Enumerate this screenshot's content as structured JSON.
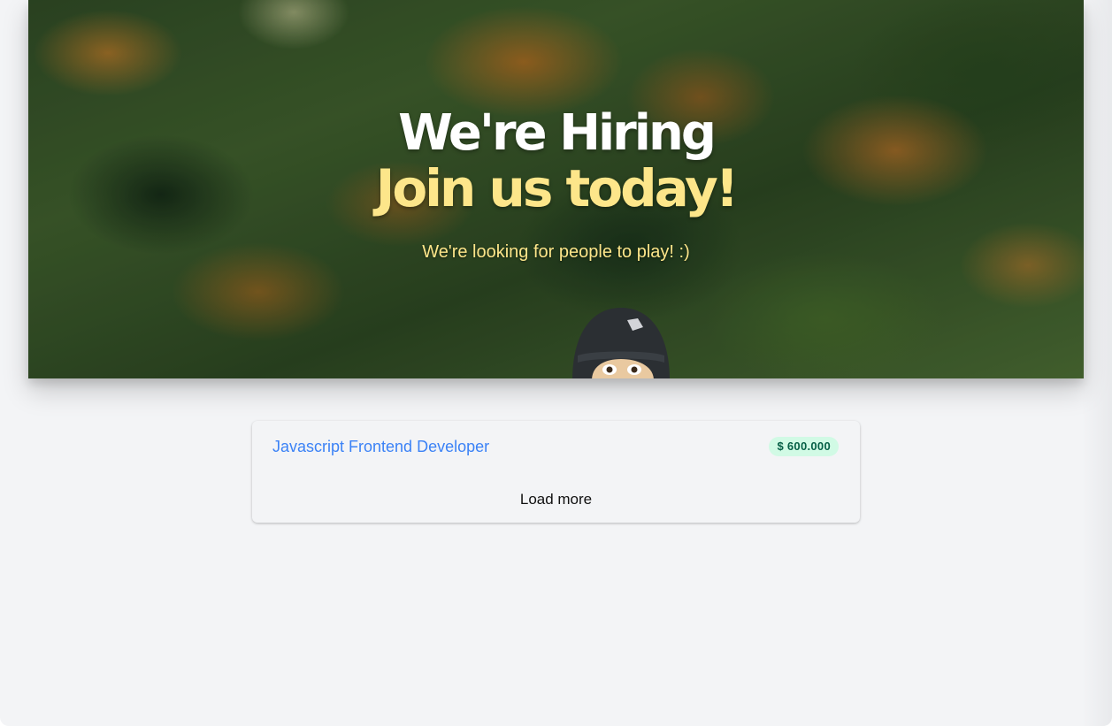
{
  "hero": {
    "title": "We're Hiring",
    "subtitle": "Join us today!",
    "tagline": "We're looking for people to play! :)",
    "background_image": "forest-trees-autumn",
    "character_image": "character-peeking-face"
  },
  "jobs": [
    {
      "title": "Javascript Frontend Developer",
      "salary": "$ 600.000"
    }
  ],
  "load_more_label": "Load more",
  "colors": {
    "accent_yellow": "#fde68a",
    "link_blue": "#3b82f6",
    "badge_bg": "#d1fae5",
    "badge_text": "#065f46",
    "page_bg": "#f3f4f6"
  }
}
